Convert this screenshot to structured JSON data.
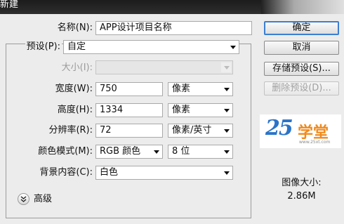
{
  "dialog": {
    "title": "新建"
  },
  "form": {
    "name_label": "名称(N):",
    "name_value": "APP设计项目名称",
    "preset_label": "预设(P):",
    "preset_value": "自定",
    "size_label": "大小(I):",
    "width_label": "宽度(W):",
    "width_value": "750",
    "width_unit": "像素",
    "height_label": "高度(H):",
    "height_value": "1334",
    "height_unit": "像素",
    "resolution_label": "分辨率(R):",
    "resolution_value": "72",
    "resolution_unit": "像素/英寸",
    "color_mode_label": "颜色模式(M):",
    "color_mode_value": "RGB 颜色",
    "bit_depth_value": "8 位",
    "background_label": "背景内容(C):",
    "background_value": "白色",
    "advanced_label": "高级"
  },
  "buttons": {
    "ok": "确定",
    "cancel": "取消",
    "save_preset": "存储预设(S)...",
    "delete_preset": "删除预设(D)..."
  },
  "watermark": {
    "number": "25",
    "text": "学堂",
    "url": "www.25xt.com",
    "colors": {
      "blue": "#2a74c9",
      "orange": "#f08a1c"
    }
  },
  "image_size": {
    "label": "图像大小:",
    "value": "2.86M"
  },
  "colors": {
    "titlebar": "#1c1c1c",
    "dialog_bg": "#ececec",
    "primary_border": "#3b7fd0"
  }
}
